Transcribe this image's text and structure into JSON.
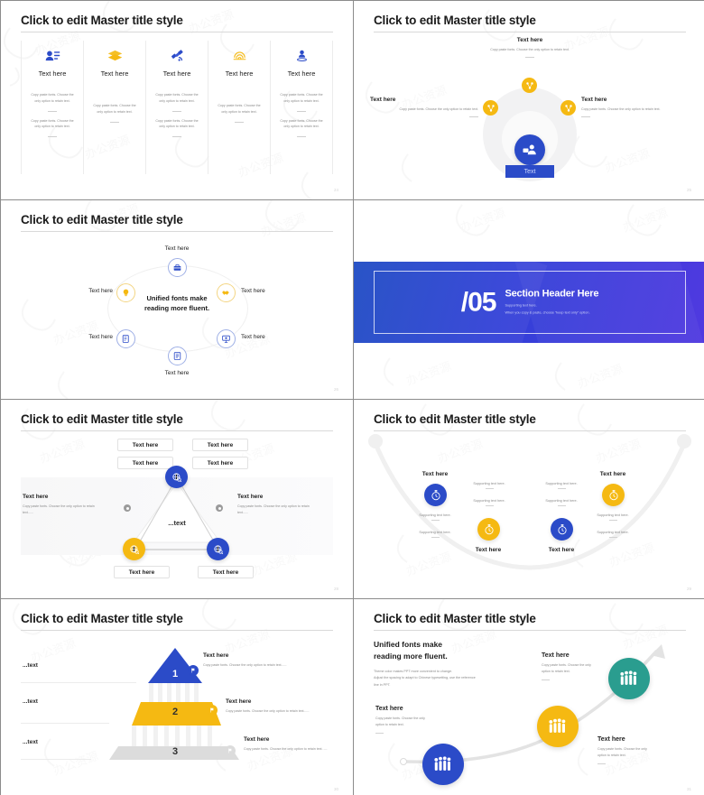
{
  "common": {
    "master_title": "Click to edit Master title style",
    "text_here": "Text here",
    "body_copy": "Copy paste fonts. Choose the only option to retain text.",
    "body_copy_short": "Copy paste fonts. Choose the only option to retain text......",
    "supporting": "Supporting text here.",
    "unified": "Unified fonts make",
    "unified2": "reading more fluent.",
    "colors": {
      "blue": "#2B4BC8",
      "yellow": "#F5B912",
      "teal": "#2A9D8F",
      "gray": "#D9D9D9",
      "text_dark": "#1B1B1B",
      "text_muted": "#8A8A8A"
    }
  },
  "slides": [
    {
      "id": "slide-24-five-column",
      "title": "Click to edit Master title style",
      "page": "24",
      "columns": [
        {
          "icon": "contact-card-icon",
          "icon_color": "#2B4BC8",
          "heading": "Text here",
          "blocks": [
            "Copy paste fonts. Choose the only option to retain text.",
            "Copy paste fonts. Choose the only option to retain text."
          ],
          "offset": "top"
        },
        {
          "icon": "layers-icon",
          "icon_color": "#F5B912",
          "heading": "Text here",
          "blocks": [
            "Copy paste fonts. Choose the only option to retain text."
          ],
          "offset": "mid"
        },
        {
          "icon": "satellite-icon",
          "icon_color": "#2B4BC8",
          "heading": "Text here",
          "blocks": [
            "Copy paste fonts. Choose the only option to retain text.",
            "Copy paste fonts. Choose the only option to retain text."
          ],
          "offset": "top"
        },
        {
          "icon": "fingerprint-icon",
          "icon_color": "#F5B912",
          "heading": "Text here",
          "blocks": [
            "Copy paste fonts. Choose the only option to retain text."
          ],
          "offset": "mid"
        },
        {
          "icon": "map-pin-person-icon",
          "icon_color": "#2B4BC8",
          "heading": "Text here",
          "blocks": [
            "Copy paste fonts. Choose the only option to retain text.",
            "Copy paste fonts. Choose the only option to retain text."
          ],
          "offset": "top"
        }
      ]
    },
    {
      "id": "slide-25-radial",
      "title": "Click to edit Master title style",
      "page": "25",
      "center_icon": "presenter-person-icon",
      "center_button": "Text",
      "nodes": [
        {
          "icon": "network-share-icon",
          "color": "#F5B912",
          "position": "top"
        },
        {
          "icon": "network-share-icon",
          "color": "#F5B912",
          "position": "left"
        },
        {
          "icon": "network-share-icon",
          "color": "#F5B912",
          "position": "right"
        }
      ],
      "labels": [
        {
          "heading": "Text here",
          "body": "Copy paste fonts. Choose the only option to retain text.",
          "align": "center",
          "position": "top"
        },
        {
          "heading": "Text here",
          "body": "Copy paste fonts. Choose the only option to retain text.",
          "align": "right",
          "position": "left"
        },
        {
          "heading": "Text here",
          "body": "Copy paste fonts. Choose the only option to retain text.",
          "align": "left",
          "position": "right"
        }
      ]
    },
    {
      "id": "slide-26-ellipse",
      "title": "Click to edit Master title style",
      "page": "26",
      "center_line1": "Unified fonts make",
      "center_line2": "reading more fluent.",
      "nodes": [
        {
          "icon": "briefcase-icon",
          "tone": "blue",
          "label": "Text here",
          "position": "top"
        },
        {
          "icon": "lightbulb-icon",
          "tone": "yellow",
          "label": "Text here",
          "position": "upper-left"
        },
        {
          "icon": "handshake-icon",
          "tone": "yellow",
          "label": "Text here",
          "position": "upper-right"
        },
        {
          "icon": "edit-document-icon",
          "tone": "blue",
          "label": "Text here",
          "position": "lower-left"
        },
        {
          "icon": "presentation-board-icon",
          "tone": "blue",
          "label": "Text here",
          "position": "lower-right"
        },
        {
          "icon": "list-document-icon",
          "tone": "blue",
          "label": "Text here",
          "position": "bottom"
        }
      ]
    },
    {
      "id": "slide-27-section-header",
      "page": "",
      "number": "/05",
      "heading": "Section Header Here",
      "sub1": "Supporting text here.",
      "sub2": "When you copy & paste, choose \"keep text only\" option."
    },
    {
      "id": "slide-28-triangle",
      "title": "Click to edit Master title style",
      "page": "28",
      "center_text": "...text",
      "chips": [
        {
          "label": "Text here",
          "position": "top-left-1"
        },
        {
          "label": "Text here",
          "position": "top-right-1"
        },
        {
          "label": "Text here",
          "position": "top-left-2"
        },
        {
          "label": "Text here",
          "position": "top-right-2"
        },
        {
          "label": "Text here",
          "position": "bottom-left"
        },
        {
          "label": "Text here",
          "position": "bottom-right"
        }
      ],
      "sides": [
        {
          "heading": "Text here",
          "body": "Copy paste fonts. Choose the only option to retain text......",
          "side": "left"
        },
        {
          "heading": "Text here",
          "body": "Copy paste fonts. Choose the only option to retain text......",
          "side": "right"
        }
      ],
      "nodes": [
        {
          "icon": "globe-search-icon",
          "color": "#2B4BC8",
          "position": "apex"
        },
        {
          "icon": "globe-search-icon",
          "color": "#F5B912",
          "position": "bottom-left"
        },
        {
          "icon": "globe-search-icon",
          "color": "#2B4BC8",
          "position": "bottom-right"
        }
      ]
    },
    {
      "id": "slide-29-wave",
      "title": "Click to edit Master title style",
      "page": "29",
      "nodes": [
        {
          "icon": "stopwatch-icon",
          "color": "#2B4BC8",
          "label": "Text here",
          "label_pos": "above",
          "supporting": [
            "Supporting text here.",
            "Supporting text here."
          ],
          "support_pos": "below"
        },
        {
          "icon": "stopwatch-icon",
          "color": "#F5B912",
          "label": "Text here",
          "label_pos": "below",
          "supporting": [
            "Supporting text here.",
            "Supporting text here."
          ],
          "support_pos": "above"
        },
        {
          "icon": "stopwatch-icon",
          "color": "#2B4BC8",
          "label": "Text here",
          "label_pos": "below",
          "supporting": [
            "Supporting text here.",
            "Supporting text here."
          ],
          "support_pos": "above"
        },
        {
          "icon": "stopwatch-icon",
          "color": "#F5B912",
          "label": "Text here",
          "label_pos": "above",
          "supporting": [
            "Supporting text here.",
            "Supporting text here."
          ],
          "support_pos": "below"
        }
      ]
    },
    {
      "id": "slide-30-pyramid",
      "title": "Click to edit Master title style",
      "page": "30",
      "tiers": [
        {
          "number": "1",
          "color": "#2B4BC8",
          "left_label": "...text",
          "heading": "Text here",
          "body": "Copy paste fonts. Choose the only option to retain text......",
          "badge_icon": "flag-icon"
        },
        {
          "number": "2",
          "color": "#F5B912",
          "left_label": "...text",
          "heading": "Text here",
          "body": "Copy paste fonts. Choose the only option to retain text......",
          "badge_icon": "flag-icon"
        },
        {
          "number": "3",
          "color": "#D9D9D9",
          "left_label": "...text",
          "heading": "Text here",
          "body": "Copy paste fonts. Choose the only option to retain text. ....",
          "badge_icon": "flag-icon"
        }
      ]
    },
    {
      "id": "slide-31-rising-arrow",
      "title": "Click to edit Master title style",
      "page": "31",
      "lead_line1": "Unified fonts make",
      "lead_line2": "reading more fluent.",
      "lead_body1": "Theme color makes PPT more convenient to change.",
      "lead_body2": "Adjust the spacing to adapt to Chinese typesetting, use the reference",
      "lead_body3": "line in PPT.",
      "nodes": [
        {
          "icon": "people-group-icon",
          "color": "#2B4BC8",
          "position": "low-left"
        },
        {
          "icon": "people-group-icon",
          "color": "#F5B912",
          "position": "mid"
        },
        {
          "icon": "people-group-icon",
          "color": "#2A9D8F",
          "position": "high-right"
        }
      ],
      "blocks": [
        {
          "heading": "Text here",
          "body1": "Copy paste fonts. Choose the only",
          "body2": "option to retain text.",
          "position": "left"
        },
        {
          "heading": "Text here",
          "body1": "Copy paste fonts. Choose the only",
          "body2": "option to retain text.",
          "position": "top"
        },
        {
          "heading": "Text here",
          "body1": "Copy paste fonts. Choose the only",
          "body2": "option to retain text.",
          "position": "right"
        }
      ]
    }
  ]
}
